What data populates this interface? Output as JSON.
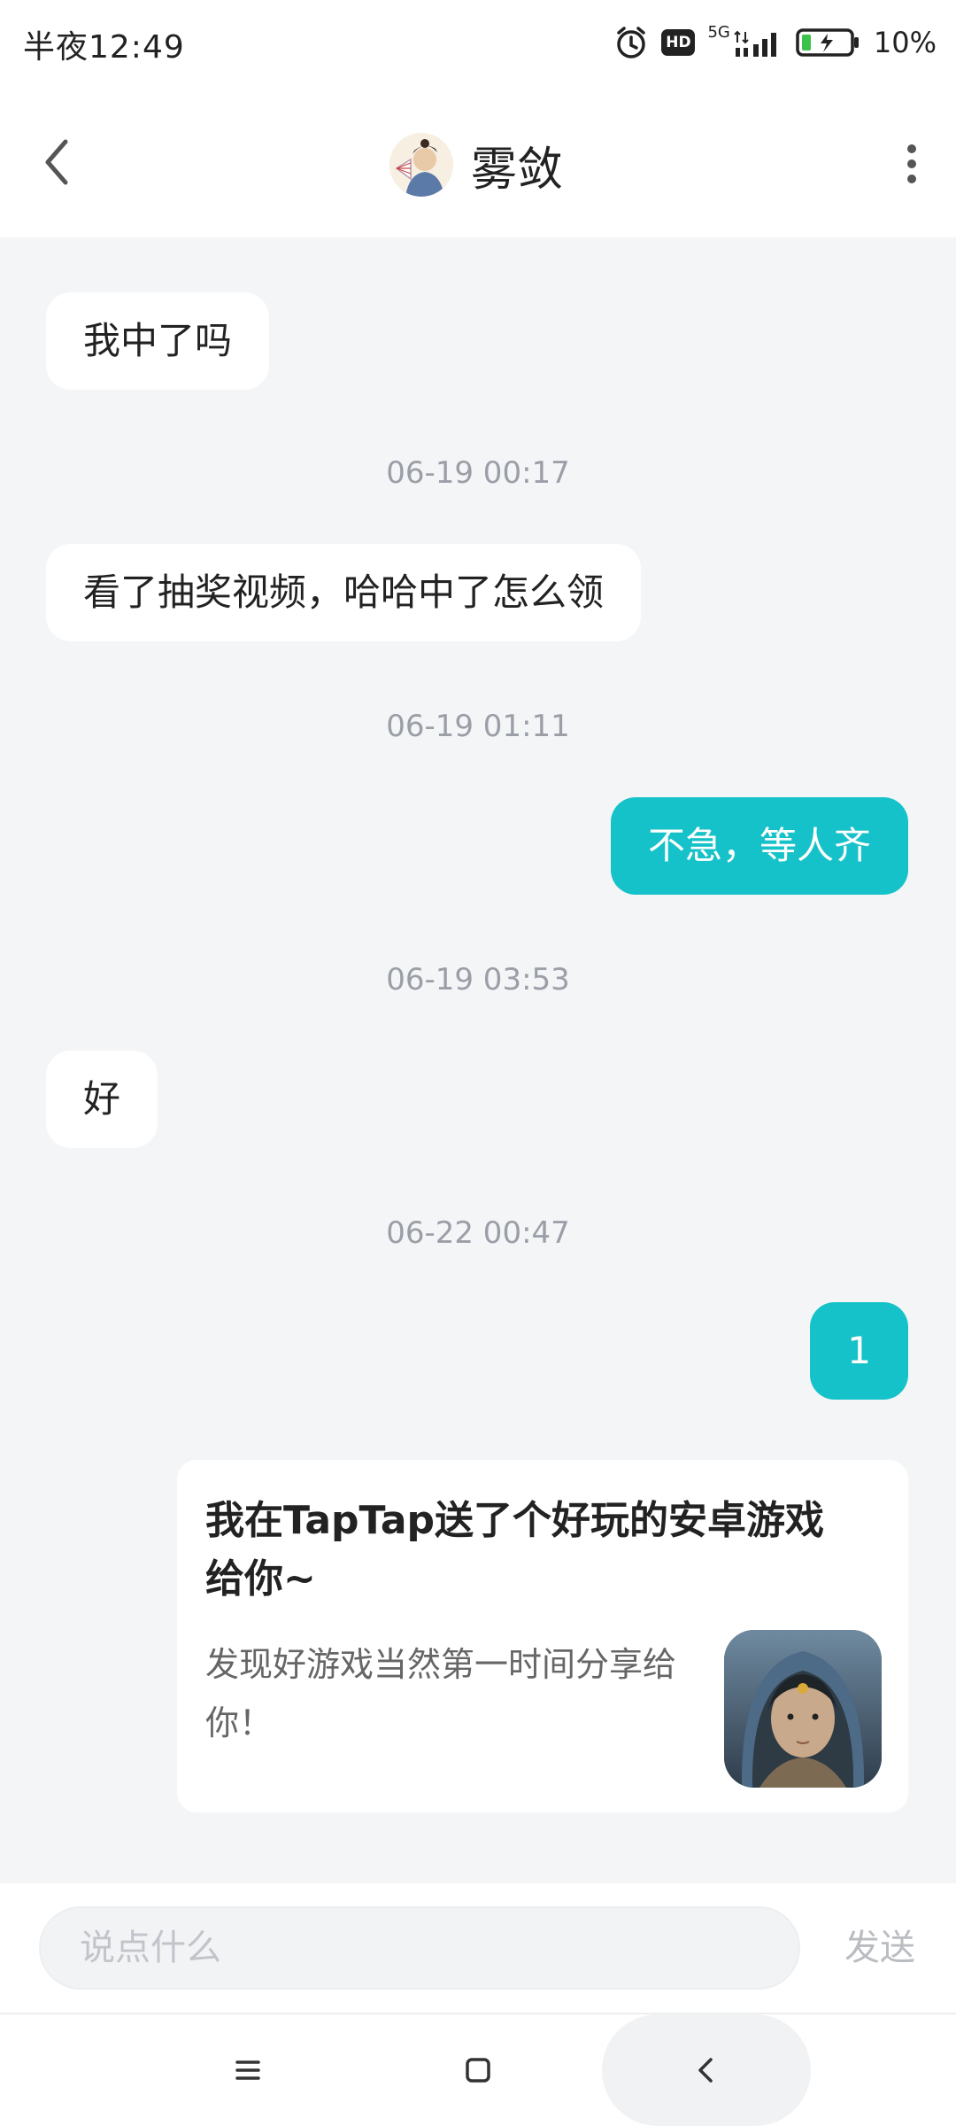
{
  "status_bar": {
    "time": "半夜12:49",
    "network": "5G",
    "hd_label": "HD",
    "battery": "10%",
    "icons": [
      "alarm-icon",
      "hd-icon",
      "signal-icon",
      "battery-charging-icon"
    ]
  },
  "header": {
    "title": "雾敛",
    "back_icon": "chevron-left-icon",
    "more_icon": "more-vertical-icon"
  },
  "messages": [
    {
      "type": "in",
      "text": "我中了吗"
    },
    {
      "type": "time",
      "text": "06-19 00:17"
    },
    {
      "type": "in",
      "text": "看了抽奖视频，哈哈中了怎么领"
    },
    {
      "type": "time",
      "text": "06-19 01:11"
    },
    {
      "type": "out",
      "text": "不急，等人齐"
    },
    {
      "type": "time",
      "text": "06-19 03:53"
    },
    {
      "type": "in",
      "text": "好"
    },
    {
      "type": "time",
      "text": "06-22 00:47"
    },
    {
      "type": "out",
      "text": "1"
    }
  ],
  "share_card": {
    "title": "我在TapTap送了个好玩的安卓游戏给你~",
    "description": "发现好游戏当然第一时间分享给你！",
    "thumbnail": "game-thumbnail-image"
  },
  "input": {
    "placeholder": "说点什么",
    "send_label": "发送"
  },
  "nav": {
    "icons": [
      "menu-icon",
      "home-square-icon",
      "back-chevron-icon"
    ]
  },
  "colors": {
    "accent": "#16c2c9",
    "background": "#f4f5f7"
  }
}
